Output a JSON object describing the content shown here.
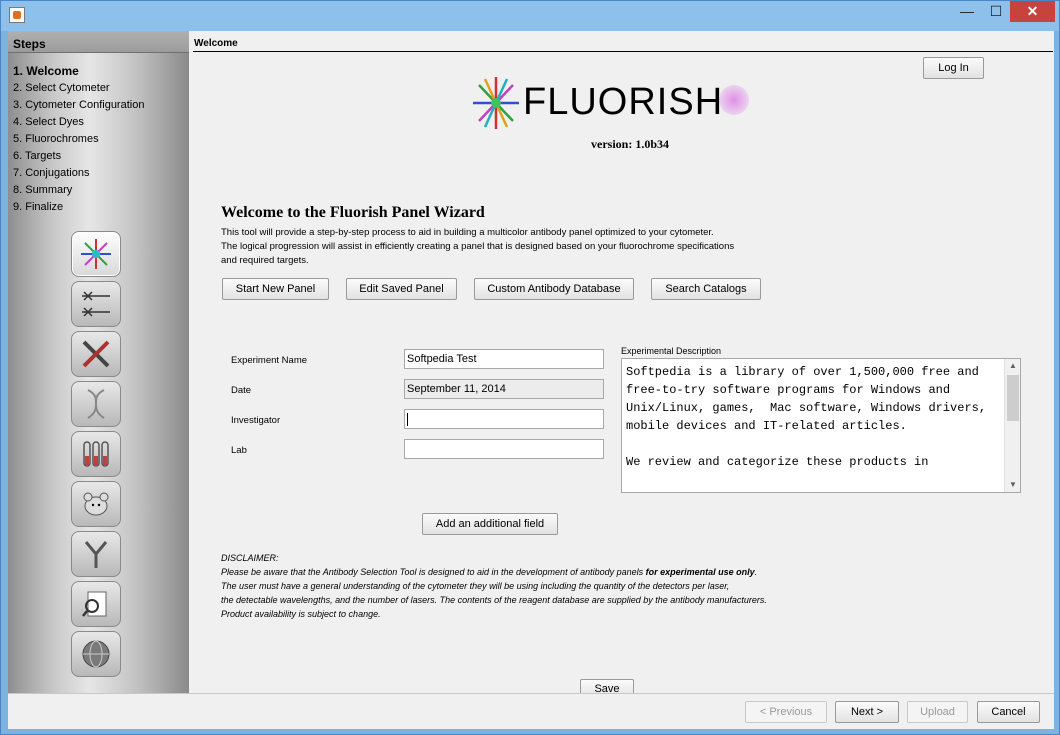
{
  "sidebar": {
    "title": "Steps",
    "steps": [
      "1. Welcome",
      "2. Select Cytometer",
      "3. Cytometer Configuration",
      "4. Select Dyes",
      "5. Fluorochromes",
      "6. Targets",
      "7. Conjugations",
      "8. Summary",
      "9. Finalize"
    ],
    "icons": [
      "fluorish-starburst-icon",
      "laser-icon",
      "tools-icon",
      "dna-icon",
      "test-tubes-icon",
      "mouse-icon",
      "antibody-icon",
      "document-search-icon",
      "globe-icon"
    ]
  },
  "main": {
    "header": "Welcome",
    "login_label": "Log In",
    "logo_text": "FLUORISH",
    "version": "version: 1.0b34",
    "welcome_title": "Welcome to the Fluorish Panel Wizard",
    "intro_lines": [
      "This tool will provide a step-by-step process to aid in building a multicolor antibody panel optimized to your cytometer.",
      "The logical progression will assist in efficiently creating a panel that is designed based on your fluorochrome specifications",
      "and required targets."
    ],
    "actions": {
      "start_new": "Start New Panel",
      "edit_saved": "Edit Saved Panel",
      "custom_db": "Custom Antibody Database",
      "search": "Search Catalogs"
    },
    "form": {
      "experiment_name_label": "Experiment Name",
      "experiment_name_value": "Softpedia Test",
      "date_label": "Date",
      "date_value": "September 11, 2014",
      "investigator_label": "Investigator",
      "investigator_value": "",
      "lab_label": "Lab",
      "lab_value": ""
    },
    "description": {
      "label": "Experimental Description",
      "text": "Softpedia is a library of over 1,500,000 free and free-to-try software programs for Windows and Unix/Linux, games,  Mac software, Windows drivers, mobile devices and IT-related articles.\n\nWe review and categorize these products in"
    },
    "add_field_label": "Add an additional field",
    "disclaimer": {
      "title": "DISCLAIMER:",
      "line1_pre": "Please be aware that the Antibody Selection Tool is designed to aid in the development of antibody panels ",
      "line1_bold": "for experimental use only",
      "line1_post": ".",
      "line2": "The user must have a general understanding of the cytometer they will be using including the quantity of the detectors per laser,",
      "line3": "the detectable wavelengths, and the number of lasers. The contents of the reagent database are supplied by the antibody manufacturers.",
      "line4": "Product availability is subject to change."
    },
    "save_label": "Save"
  },
  "footer": {
    "previous": "< Previous",
    "next": "Next >",
    "upload": "Upload",
    "cancel": "Cancel"
  },
  "window": {
    "min_glyph": "—",
    "max_glyph": "☐",
    "close_glyph": "✕"
  }
}
